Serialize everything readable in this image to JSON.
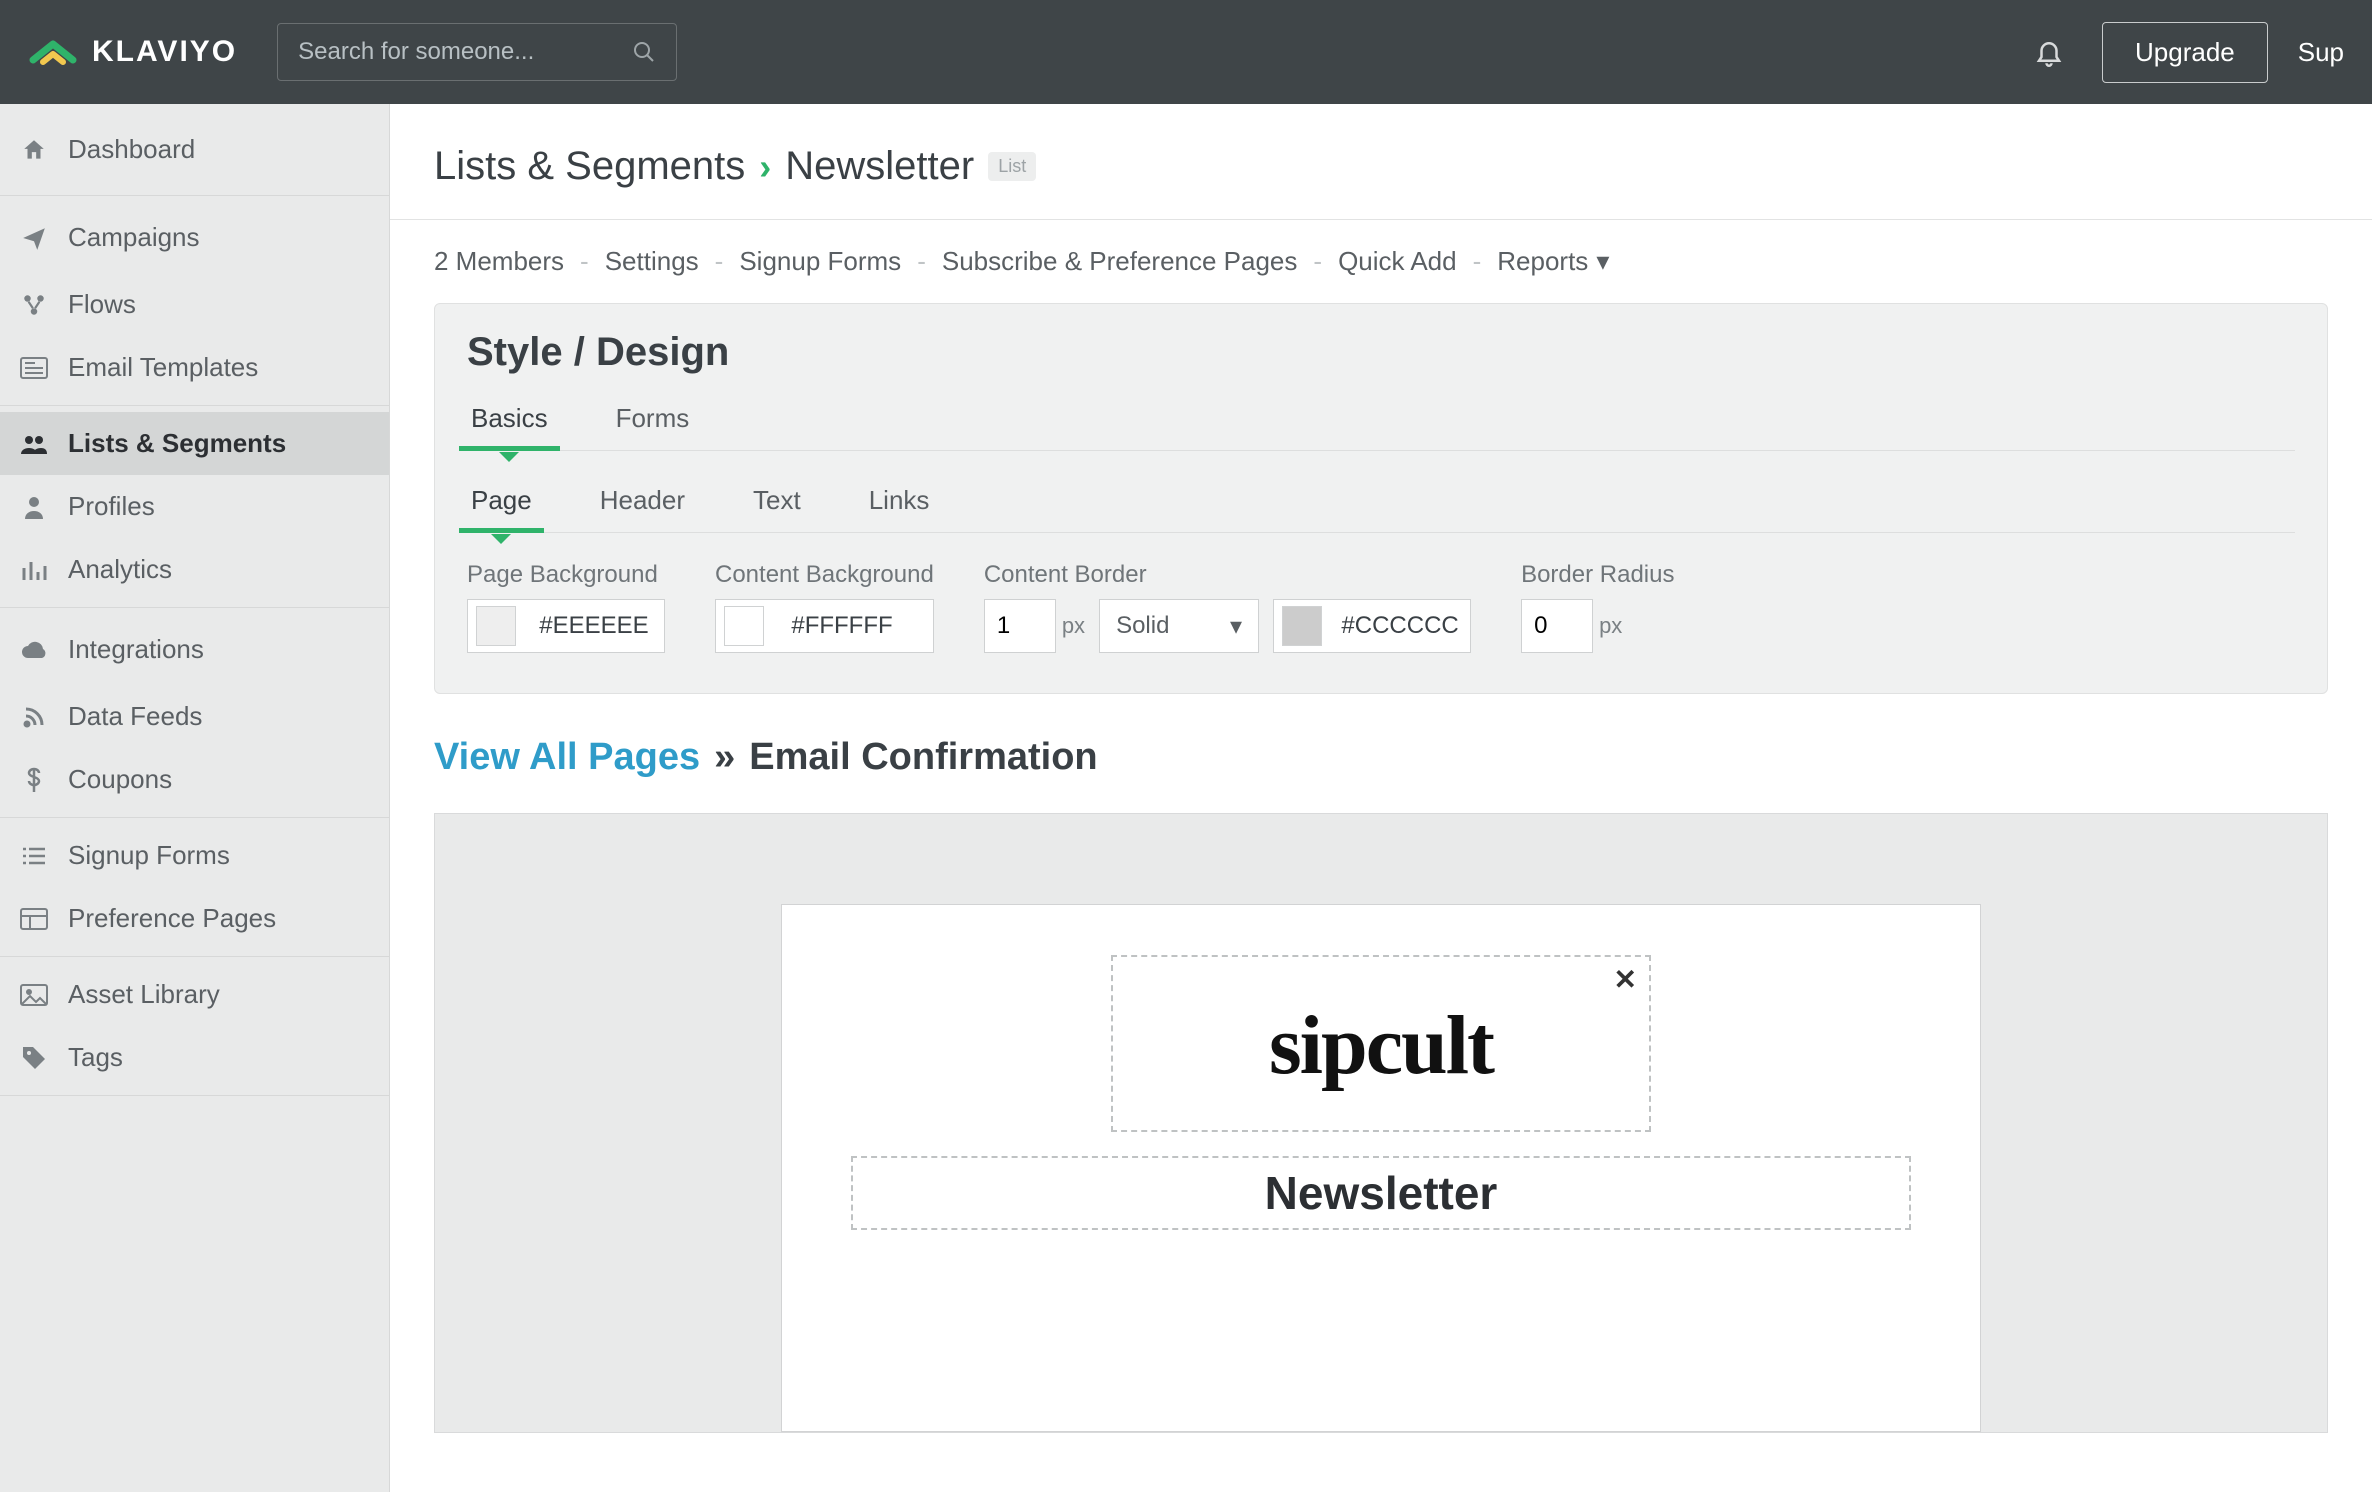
{
  "header": {
    "brand": "KLAVIYO",
    "search_placeholder": "Search for someone...",
    "upgrade": "Upgrade",
    "support": "Sup"
  },
  "sidebar": {
    "dashboard": "Dashboard",
    "campaigns": "Campaigns",
    "flows": "Flows",
    "email_templates": "Email Templates",
    "lists_segments": "Lists & Segments",
    "profiles": "Profiles",
    "analytics": "Analytics",
    "integrations": "Integrations",
    "data_feeds": "Data Feeds",
    "coupons": "Coupons",
    "signup_forms": "Signup Forms",
    "preference_pages": "Preference Pages",
    "asset_library": "Asset Library",
    "tags": "Tags"
  },
  "breadcrumb": {
    "root": "Lists & Segments",
    "current": "Newsletter",
    "badge": "List"
  },
  "subnav": {
    "members": "2 Members",
    "settings": "Settings",
    "signup_forms": "Signup Forms",
    "subscribe": "Subscribe & Preference Pages",
    "quick_add": "Quick Add",
    "reports": "Reports"
  },
  "style_panel": {
    "title": "Style / Design",
    "tabs": {
      "basics": "Basics",
      "forms": "Forms"
    },
    "subtabs": {
      "page": "Page",
      "header": "Header",
      "text": "Text",
      "links": "Links"
    },
    "fields": {
      "page_bg": {
        "label": "Page Background",
        "value": "#EEEEEE"
      },
      "content_bg": {
        "label": "Content Background",
        "value": "#FFFFFF"
      },
      "content_border": {
        "label": "Content Border",
        "width": "1",
        "unit": "px",
        "style": "Solid",
        "color": "#CCCCCC"
      },
      "border_radius": {
        "label": "Border Radius",
        "value": "0",
        "unit": "px"
      }
    }
  },
  "view": {
    "link": "View All Pages",
    "sep": "»",
    "title": "Email Confirmation"
  },
  "preview": {
    "brand_logo": "sipcult",
    "newsletter_title": "Newsletter"
  }
}
